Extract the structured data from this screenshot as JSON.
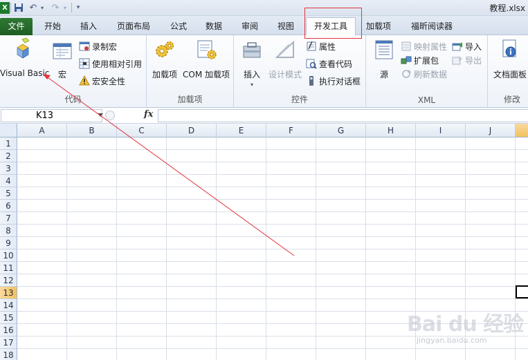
{
  "window": {
    "title": "教程.xlsx"
  },
  "quick_access": {
    "save_icon": "save-icon",
    "undo_icon": "undo-icon",
    "redo_icon": "redo-icon"
  },
  "tabs": [
    {
      "label": "文件"
    },
    {
      "label": "开始"
    },
    {
      "label": "插入"
    },
    {
      "label": "页面布局"
    },
    {
      "label": "公式"
    },
    {
      "label": "数据"
    },
    {
      "label": "审阅"
    },
    {
      "label": "视图"
    },
    {
      "label": "开发工具"
    },
    {
      "label": "加载项"
    },
    {
      "label": "福昕阅读器"
    }
  ],
  "ribbon": {
    "code": {
      "group_label": "代码",
      "visual_basic": "Visual Basic",
      "macros": "宏",
      "record_macro": "录制宏",
      "relative_ref": "使用相对引用",
      "macro_security": "宏安全性"
    },
    "addins": {
      "group_label": "加载项",
      "addins": "加载项",
      "com_addins": "COM 加载项"
    },
    "controls": {
      "group_label": "控件",
      "insert": "插入",
      "design_mode": "设计模式",
      "properties": "属性",
      "view_code": "查看代码",
      "run_dialog": "执行对话框"
    },
    "xml": {
      "group_label": "XML",
      "source": "源",
      "map_properties": "映射属性",
      "expansion_packs": "扩展包",
      "refresh_data": "刷新数据",
      "import": "导入",
      "export": "导出"
    },
    "modify": {
      "group_label": "修改",
      "doc_panel": "文档面板"
    }
  },
  "formula_bar": {
    "name_box": "K13",
    "fx": "fx",
    "formula": ""
  },
  "sheet": {
    "columns": [
      "A",
      "B",
      "C",
      "D",
      "E",
      "F",
      "G",
      "H",
      "I",
      "J"
    ],
    "rows": [
      "1",
      "2",
      "3",
      "4",
      "5",
      "6",
      "7",
      "8",
      "9",
      "10",
      "11",
      "12",
      "13",
      "14",
      "15",
      "16",
      "17",
      "18"
    ],
    "selected_row": "13",
    "selected_cell": "K13"
  },
  "annotation": {
    "highlight_color": "#e2343a",
    "arrow_color": "#e2343a"
  },
  "watermark": {
    "logo": "Bai du 经验",
    "url": "jingyan.baidu.com"
  }
}
